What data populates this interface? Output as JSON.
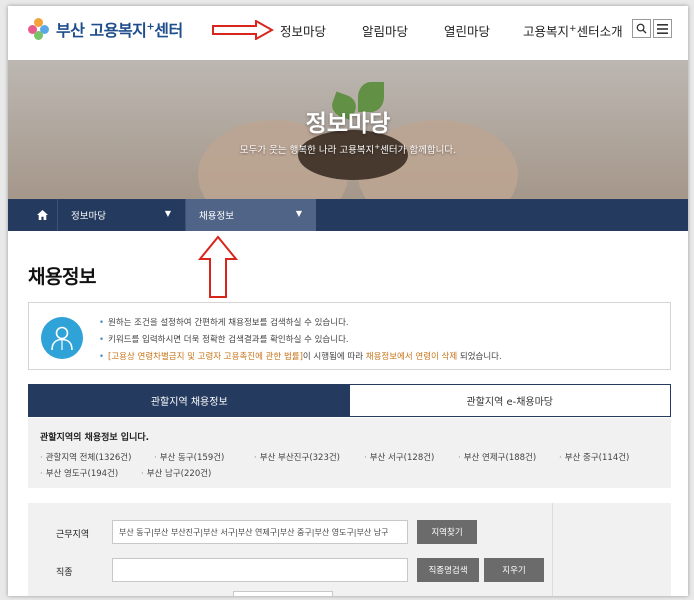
{
  "header": {
    "logo_text": "부산 고용복지",
    "logo_sup": "+",
    "logo_suffix": "센터",
    "nav": [
      {
        "label": "정보마당"
      },
      {
        "label": "알림마당"
      },
      {
        "label": "열린마당"
      },
      {
        "label_pre": "고용복지",
        "label_sup": "+",
        "label_post": "센터소개"
      }
    ],
    "search_icon": "search-icon",
    "menu_icon": "hamburger-menu-icon"
  },
  "hero": {
    "title": "정보마당",
    "subtitle_pre": "모두가 웃는 행복한 나라 고용복지",
    "subtitle_sup": "+",
    "subtitle_post": "센터가 함께합니다."
  },
  "breadcrumb": {
    "home_icon": "home-icon",
    "level1": "정보마당",
    "level2": "채용정보"
  },
  "page": {
    "title": "채용정보"
  },
  "notice": {
    "icon": "user-icon",
    "line1": "원하는 조건을 설정하여 간편하게 채용정보를 검색하실 수 있습니다.",
    "line2": "키워드를 입력하시면 더욱 정확한 검색결과를 확인하실 수 있습니다.",
    "line3_a": "[고용상 연령차별금지 및 고령자 고용촉진에 관한 법률]",
    "line3_b": "이 시행됨에 따라 ",
    "line3_c": "채용정보에서 연령이 삭제",
    "line3_d": " 되었습니다."
  },
  "tabs": [
    {
      "label": "관할지역 채용정보",
      "active": true
    },
    {
      "label": "관할지역 e-채용마당",
      "active": false
    }
  ],
  "region": {
    "title": "관할지역의 채용정보 입니다.",
    "items": [
      "관할지역 전체(1326건)",
      "부산 동구(159건)",
      "부산 부산진구(323건)",
      "부산 서구(128건)",
      "부산 연제구(188건)",
      "부산 중구(114건)",
      "부산 영도구(194건)",
      "부산 남구(220건)"
    ]
  },
  "search": {
    "work_area_label": "근무지역",
    "work_area_value": "부산 동구|부산 부산진구|부산 서구|부산 연제구|부산 중구|부산 영도구|부산 남구",
    "find_area_button": "지역찾기",
    "job_label": "직종",
    "job_value": "",
    "job_search_button": "직종명검색",
    "clear_button": "지우기"
  },
  "colors": {
    "navy": "#243a5e",
    "crumb_active": "#4f6487",
    "notice_icon": "#2fa2d8",
    "highlight": "#c8751a",
    "annotation_arrow": "#d9261c"
  }
}
